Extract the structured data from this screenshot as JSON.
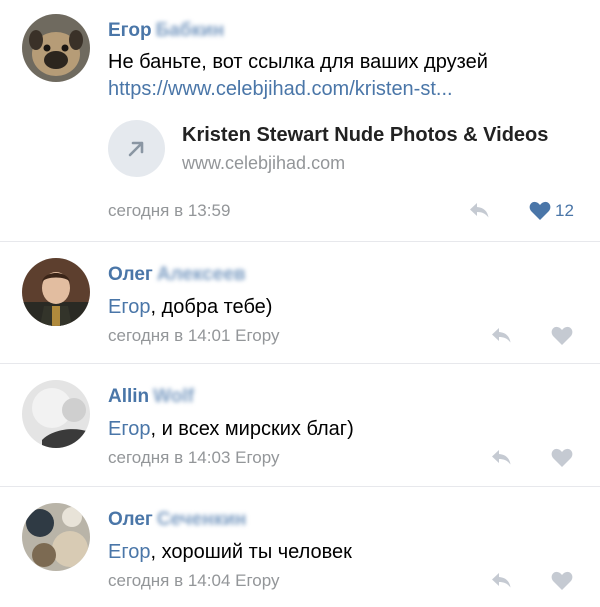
{
  "comments": [
    {
      "author_name": "Егор",
      "author_blurred": "Бабкин",
      "text": "Не баньте, вот ссылка для ваших друзей",
      "link": "https://www.celebjihad.com/kristen-st...",
      "attachment": {
        "title": "Kristen Stewart Nude Photos & Videos",
        "url": "www.celebjihad.com"
      },
      "time": "сегодня в 13:59",
      "likes": "12",
      "liked": true
    },
    {
      "author_name": "Олег",
      "author_blurred": "Алексеев",
      "reply_to": "Егор",
      "text": ", добра тебе)",
      "time": "сегодня в 14:01 Егору"
    },
    {
      "author_name": "Allin",
      "author_blurred": "Wolf",
      "reply_to": "Егор",
      "text": ", и всех мирских благ)",
      "time": "сегодня в 14:03 Егору"
    },
    {
      "author_name": "Олег",
      "author_blurred": "Сеченкин",
      "reply_to": "Егор",
      "text": ", хороший ты человек",
      "time": "сегодня в 14:04 Егору"
    }
  ],
  "colors": {
    "accent": "#4a76a8",
    "meta": "#939699",
    "icon_gray": "#c5cad2",
    "divider": "#e7e8ec"
  },
  "icons": {
    "reply": "reply-arrow-icon",
    "like": "heart-icon",
    "link": "arrow-up-right-icon"
  }
}
